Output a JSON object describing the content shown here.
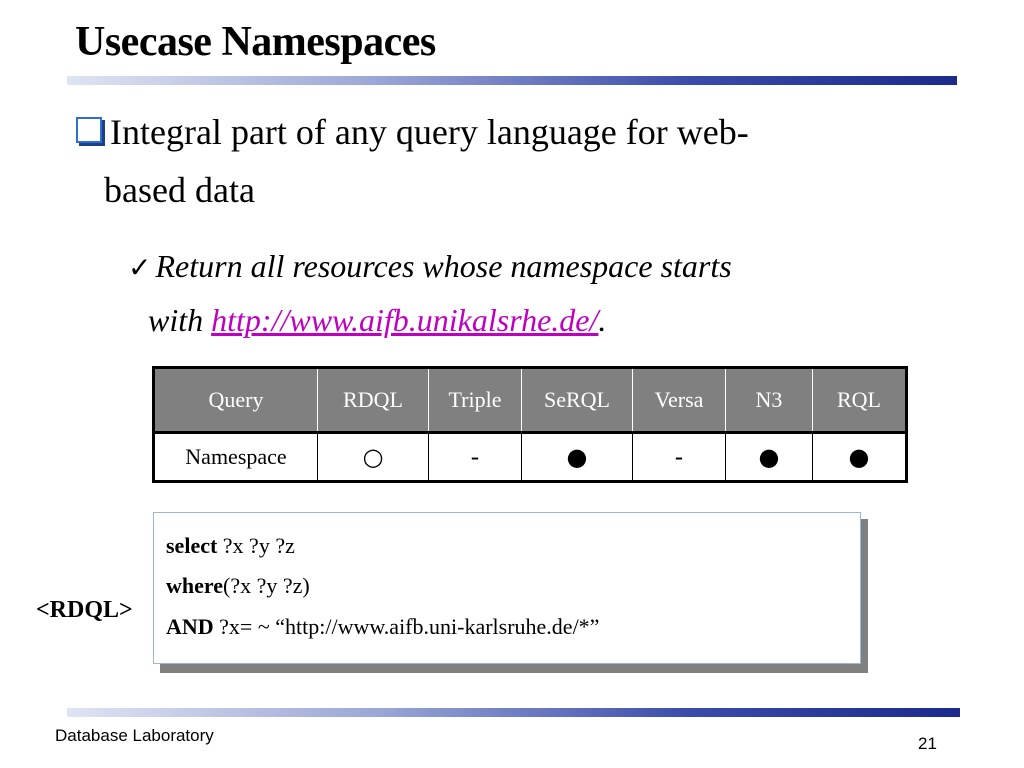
{
  "slide": {
    "title": "Usecase Namespaces",
    "bullet": {
      "line1": "Integral part of any query language for web-",
      "line2": "based data"
    },
    "sub_bullet": {
      "check_icon": "✓",
      "line1": "Return all resources whose namespace starts",
      "line2_prefix": "with ",
      "link": "http://www.aifb.unikalsrhe.de/",
      "line2_suffix": "."
    }
  },
  "table": {
    "headers": [
      "Query",
      "RDQL",
      "Triple",
      "SeRQL",
      "Versa",
      "N3",
      "RQL"
    ],
    "row": {
      "label": "Namespace",
      "cells": [
        "○",
        "-",
        "●",
        "-",
        "●",
        "●"
      ]
    }
  },
  "code": {
    "label": "<RDQL>",
    "line1": {
      "kw": "select",
      "rest": " ?x ?y ?z"
    },
    "line2": {
      "kw": "where",
      "rest": "(?x ?y ?z)"
    },
    "line3": {
      "kw": "AND",
      "rest": " ?x= ~ “http://www.aifb.uni-karlsruhe.de/*”"
    }
  },
  "footer": {
    "left": "Database Laboratory",
    "page": "21"
  },
  "colors": {
    "header_bg": "#808080",
    "link": "#c000c0",
    "rule_dark": "#1b2a8c",
    "bullet_box": "#2d6ed0"
  }
}
